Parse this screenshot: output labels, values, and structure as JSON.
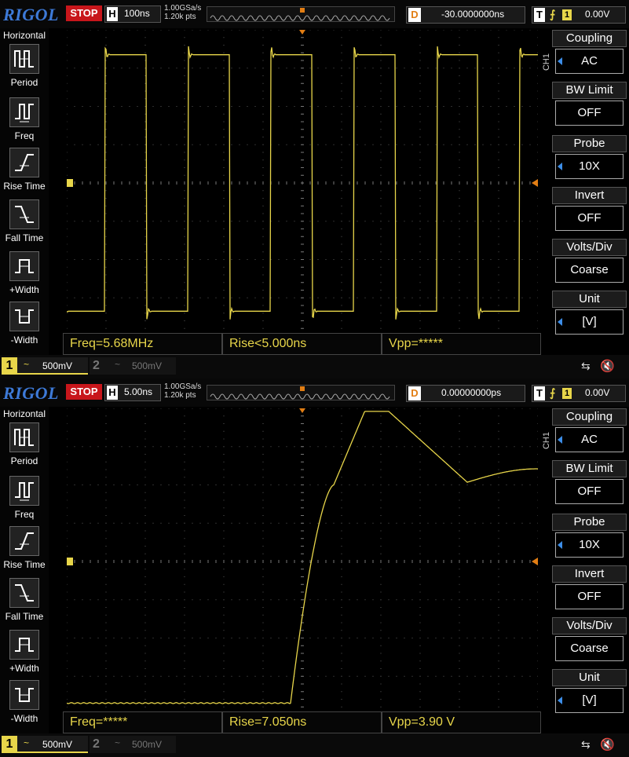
{
  "screens": [
    {
      "brand": "RIGOL",
      "run_state": "STOP",
      "timebase": {
        "letter": "H",
        "value": "100ns"
      },
      "sample_rate": "1.00GSa/s",
      "memory_depth": "1.20k pts",
      "delay": {
        "letter": "D",
        "value": "-30.0000000ns"
      },
      "trigger": {
        "letter": "T",
        "edge": "⨍",
        "source": "1",
        "level": "0.00V"
      },
      "left_menu": {
        "title": "Horizontal",
        "items": [
          "Period",
          "Freq",
          "Rise Time",
          "Fall Time",
          "+Width",
          "-Width"
        ]
      },
      "measurements": [
        "Freq=5.68MHz",
        "Rise<5.000ns",
        "Vpp=*****"
      ],
      "right_menu": {
        "channel": "CH1",
        "items": [
          {
            "label": "Coupling",
            "value": "AC"
          },
          {
            "label": "BW Limit",
            "value": "OFF"
          },
          {
            "label": "Probe",
            "value": "10X"
          },
          {
            "label": "Invert",
            "value": "OFF"
          },
          {
            "label": "Volts/Div",
            "value": "Coarse"
          },
          {
            "label": "Unit",
            "value": "[V]"
          }
        ]
      },
      "channels": [
        {
          "num": "1",
          "coupling": "~",
          "scale": "500mV"
        },
        {
          "num": "2",
          "coupling": "~",
          "scale": "500mV"
        }
      ],
      "trace_color": "#e8d64a",
      "waveform": {
        "type": "square",
        "description_visible": false,
        "periods_shown": 5.68,
        "high_level_div": 0.65,
        "low_level_div": 7.35
      }
    },
    {
      "brand": "RIGOL",
      "run_state": "STOP",
      "timebase": {
        "letter": "H",
        "value": "5.00ns"
      },
      "sample_rate": "1.00GSa/s",
      "memory_depth": "1.20k pts",
      "delay": {
        "letter": "D",
        "value": "0.00000000ps"
      },
      "trigger": {
        "letter": "T",
        "edge": "⨍",
        "source": "1",
        "level": "0.00V"
      },
      "left_menu": {
        "title": "Horizontal",
        "items": [
          "Period",
          "Freq",
          "Rise Time",
          "Fall Time",
          "+Width",
          "-Width"
        ]
      },
      "measurements": [
        "Freq=*****",
        "Rise=7.050ns",
        "Vpp=3.90 V"
      ],
      "right_menu": {
        "channel": "CH1",
        "items": [
          {
            "label": "Coupling",
            "value": "AC"
          },
          {
            "label": "BW Limit",
            "value": "OFF"
          },
          {
            "label": "Probe",
            "value": "10X"
          },
          {
            "label": "Invert",
            "value": "OFF"
          },
          {
            "label": "Volts/Div",
            "value": "Coarse"
          },
          {
            "label": "Unit",
            "value": "[V]"
          }
        ]
      },
      "channels": [
        {
          "num": "1",
          "coupling": "~",
          "scale": "500mV"
        },
        {
          "num": "2",
          "coupling": "~",
          "scale": "500mV"
        }
      ],
      "trace_color": "#e8d64a",
      "waveform": {
        "type": "rising-edge"
      }
    }
  ],
  "colors": {
    "brand_blue": "#3d7ad8",
    "stop_red": "#c8161b",
    "trigger_orange": "#e27e14",
    "ch1_yellow": "#e8d64a",
    "grid_dots": "#5a5a5a"
  },
  "icons": {
    "usb": "usb-icon",
    "speaker": "speaker-muted-icon"
  }
}
